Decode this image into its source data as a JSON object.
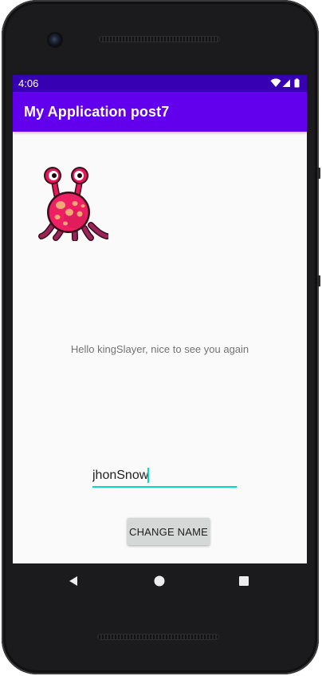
{
  "status_bar": {
    "time": "4:06",
    "background": "#3700b3",
    "icons": [
      "wifi-icon",
      "cell-signal-icon",
      "battery-icon"
    ]
  },
  "app_bar": {
    "title": "My Application post7",
    "background": "#6200ee"
  },
  "content": {
    "image_icon": "monster-icon",
    "greeting": "Hello kingSlayer, nice to see you again",
    "name_input": {
      "value": "jhonSnow",
      "underline_color": "#03dac5"
    },
    "change_button_label": "CHANGE NAME"
  },
  "nav_bar": {
    "icons": [
      "back-icon",
      "home-icon",
      "recents-icon"
    ]
  }
}
